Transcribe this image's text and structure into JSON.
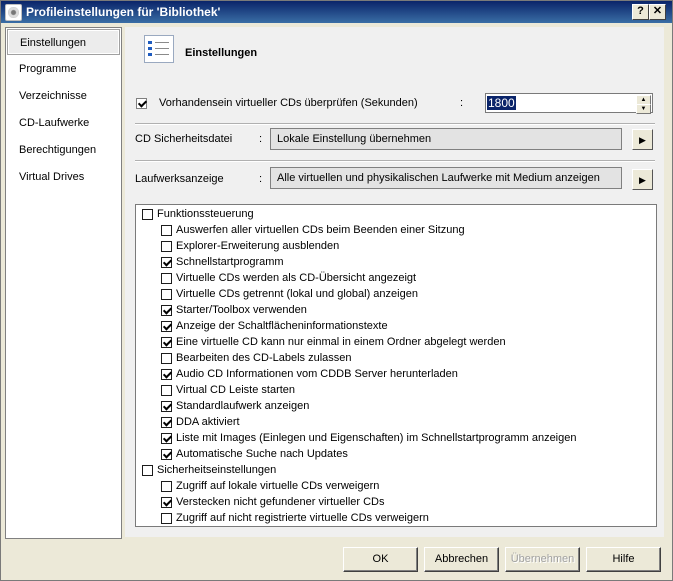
{
  "window": {
    "title": "Profileinstellungen für 'Bibliothek'",
    "help_label": "?",
    "close_label": "✕"
  },
  "sidebar": {
    "items": [
      {
        "label": "Einstellungen",
        "active": true
      },
      {
        "label": "Programme",
        "active": false
      },
      {
        "label": "Verzeichnisse",
        "active": false
      },
      {
        "label": "CD-Laufwerke",
        "active": false
      },
      {
        "label": "Berechtigungen",
        "active": false
      },
      {
        "label": "Virtual Drives",
        "active": false
      }
    ]
  },
  "section": {
    "icon": "checklist-icon",
    "title": "Einstellungen"
  },
  "check_virtual": {
    "label": "Vorhandensein virtueller CDs überprüfen (Sekunden)",
    "checked": true,
    "separator": ":",
    "value": "1800"
  },
  "cd_security": {
    "label": "CD Sicherheitsdatei",
    "separator": ":",
    "value": "Lokale Einstellung übernehmen",
    "button": "▶"
  },
  "drive_display": {
    "label": "Laufwerksanzeige",
    "separator": ":",
    "value": "Alle virtuellen und physikalischen Laufwerke mit Medium anzeigen",
    "button": "▶"
  },
  "tree": {
    "groups": [
      {
        "label": "Funktionssteuerung",
        "checked": false,
        "items": [
          {
            "label": "Auswerfen aller virtuellen CDs beim Beenden einer Sitzung",
            "checked": false
          },
          {
            "label": "Explorer-Erweiterung ausblenden",
            "checked": false
          },
          {
            "label": "Schnellstartprogramm",
            "checked": true
          },
          {
            "label": "Virtuelle CDs werden als CD-Übersicht angezeigt",
            "checked": false
          },
          {
            "label": "Virtuelle CDs getrennt (lokal und global) anzeigen",
            "checked": false
          },
          {
            "label": "Starter/Toolbox verwenden",
            "checked": true
          },
          {
            "label": "Anzeige der Schaltflächeninformationstexte",
            "checked": true
          },
          {
            "label": "Eine virtuelle CD kann nur einmal in einem Ordner abgelegt werden",
            "checked": true
          },
          {
            "label": "Bearbeiten des CD-Labels zulassen",
            "checked": false
          },
          {
            "label": "Audio CD Informationen vom CDDB Server herunterladen",
            "checked": true
          },
          {
            "label": "Virtual CD Leiste starten",
            "checked": false
          },
          {
            "label": "Standardlaufwerk anzeigen",
            "checked": true
          },
          {
            "label": "DDA aktiviert",
            "checked": true
          },
          {
            "label": "Liste mit Images (Einlegen und Eigenschaften) im Schnellstartprogramm anzeigen",
            "checked": true
          },
          {
            "label": "Automatische Suche nach Updates",
            "checked": true
          }
        ]
      },
      {
        "label": "Sicherheitseinstellungen",
        "checked": false,
        "items": [
          {
            "label": "Zugriff auf lokale virtuelle CDs verweigern",
            "checked": false
          },
          {
            "label": "Verstecken nicht gefundener virtueller CDs",
            "checked": true
          },
          {
            "label": "Zugriff auf nicht registrierte virtuelle CDs verweigern",
            "checked": false
          }
        ]
      }
    ]
  },
  "buttons": {
    "ok": "OK",
    "cancel": "Abbrechen",
    "apply": "Übernehmen",
    "help": "Hilfe"
  }
}
